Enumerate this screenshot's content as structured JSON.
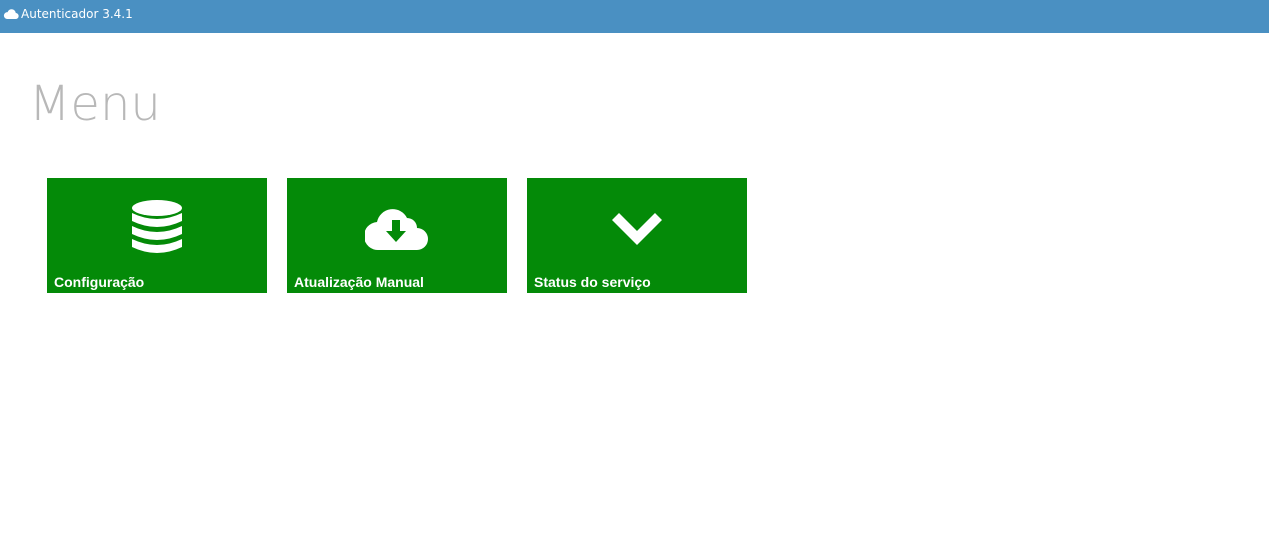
{
  "app": {
    "title": "Autenticador 3.4.1",
    "icon": "cloud-icon"
  },
  "page": {
    "title": "Menu"
  },
  "tiles": [
    {
      "label": "Configuração",
      "icon": "database-icon",
      "color": "#048a08"
    },
    {
      "label": "Atualização Manual",
      "icon": "cloud-download-icon",
      "color": "#048a08"
    },
    {
      "label": "Status do serviço",
      "icon": "chevron-down-icon",
      "color": "#048a08"
    }
  ],
  "colors": {
    "titlebar": "#4a90c2",
    "tile": "#048a08",
    "page_title": "#b8b8b8"
  }
}
